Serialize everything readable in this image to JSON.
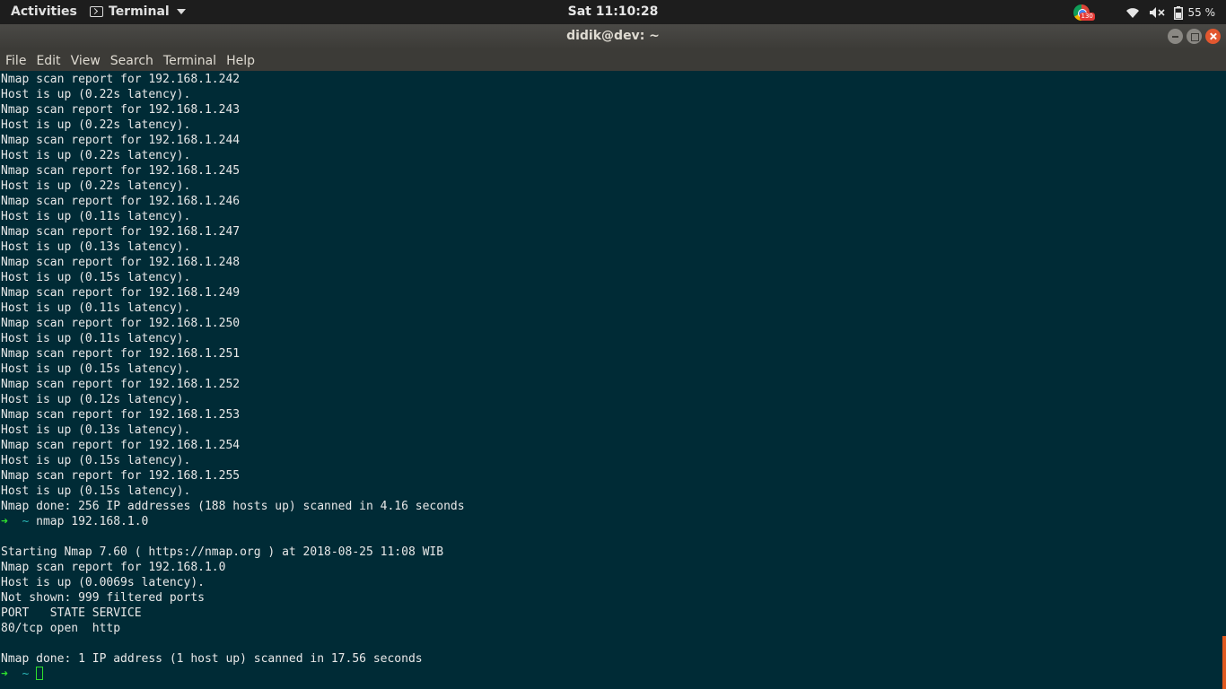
{
  "topbar": {
    "activities": "Activities",
    "app_name": "Terminal",
    "clock": "Sat 11:10:28",
    "notification_badge": "130",
    "battery_text": "55 %"
  },
  "window": {
    "title": "didik@dev: ~"
  },
  "menu": [
    "File",
    "Edit",
    "View",
    "Search",
    "Terminal",
    "Help"
  ],
  "colors": {
    "terminal_bg": "#002b36",
    "prompt_arrow": "#2ee02e",
    "prompt_dir": "#2ab7b7",
    "close_button": "#e2572f"
  },
  "terminal": {
    "lines": [
      "Nmap scan report for 192.168.1.242",
      "Host is up (0.22s latency).",
      "Nmap scan report for 192.168.1.243",
      "Host is up (0.22s latency).",
      "Nmap scan report for 192.168.1.244",
      "Host is up (0.22s latency).",
      "Nmap scan report for 192.168.1.245",
      "Host is up (0.22s latency).",
      "Nmap scan report for 192.168.1.246",
      "Host is up (0.11s latency).",
      "Nmap scan report for 192.168.1.247",
      "Host is up (0.13s latency).",
      "Nmap scan report for 192.168.1.248",
      "Host is up (0.15s latency).",
      "Nmap scan report for 192.168.1.249",
      "Host is up (0.11s latency).",
      "Nmap scan report for 192.168.1.250",
      "Host is up (0.11s latency).",
      "Nmap scan report for 192.168.1.251",
      "Host is up (0.15s latency).",
      "Nmap scan report for 192.168.1.252",
      "Host is up (0.12s latency).",
      "Nmap scan report for 192.168.1.253",
      "Host is up (0.13s latency).",
      "Nmap scan report for 192.168.1.254",
      "Host is up (0.15s latency).",
      "Nmap scan report for 192.168.1.255",
      "Host is up (0.15s latency).",
      "Nmap done: 256 IP addresses (188 hosts up) scanned in 4.16 seconds"
    ],
    "prompt_arrow": "➜",
    "prompt_dir": "~",
    "command": "nmap 192.168.1.0",
    "output": [
      "",
      "Starting Nmap 7.60 ( https://nmap.org ) at 2018-08-25 11:08 WIB",
      "Nmap scan report for 192.168.1.0",
      "Host is up (0.0069s latency).",
      "Not shown: 999 filtered ports",
      "PORT   STATE SERVICE",
      "80/tcp open  http",
      "",
      "Nmap done: 1 IP address (1 host up) scanned in 17.56 seconds"
    ]
  }
}
